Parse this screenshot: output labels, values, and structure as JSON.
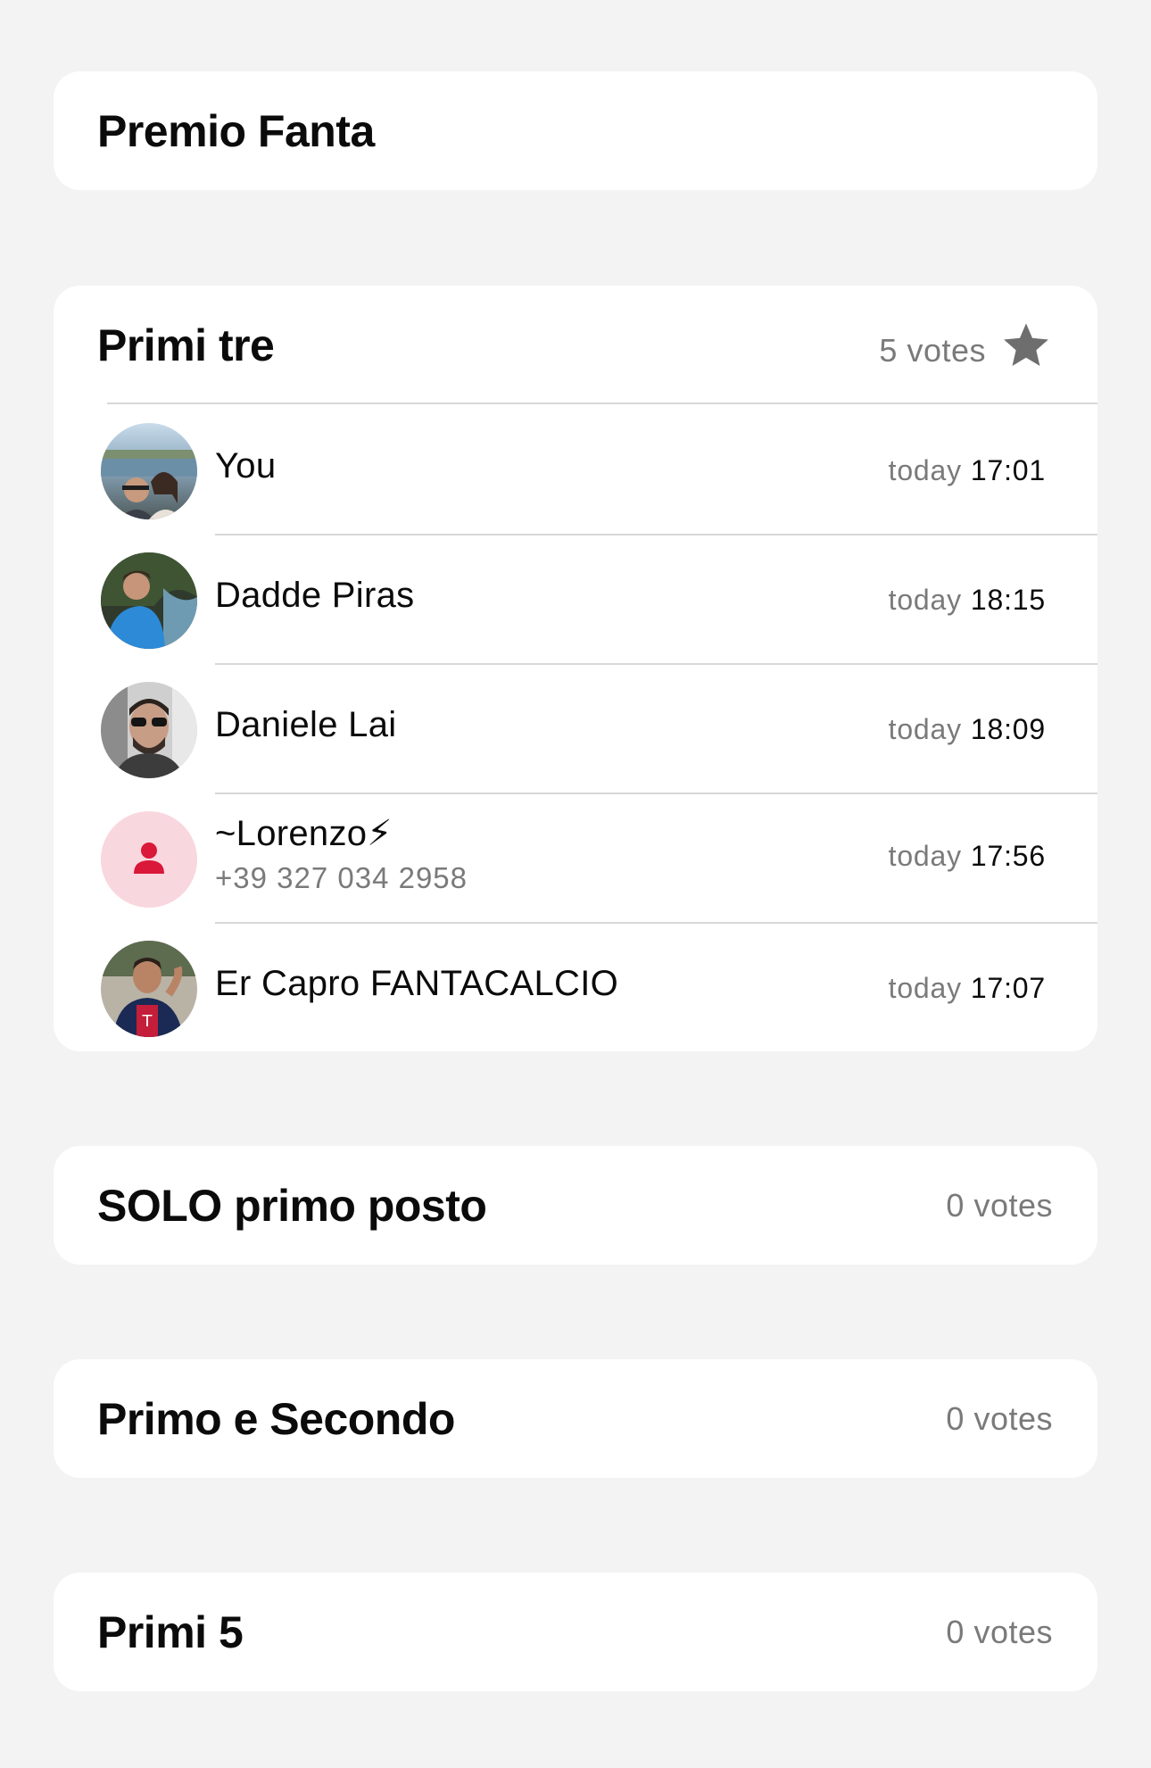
{
  "poll_title": "Premio Fanta",
  "options": [
    {
      "label": "Primi tre",
      "votes_text": "5 votes",
      "starred": true,
      "voters": [
        {
          "name": "You",
          "sub": "",
          "day": "today",
          "time": "17:01",
          "avatar": "photo-couple-avatar"
        },
        {
          "name": "Dadde Piras",
          "sub": "",
          "day": "today",
          "time": "18:15",
          "avatar": "photo-avatar"
        },
        {
          "name": "Daniele Lai",
          "sub": "",
          "day": "today",
          "time": "18:09",
          "avatar": "photo-avatar"
        },
        {
          "name": "~Lorenzo⚡",
          "sub": "+39 327 034 2958",
          "day": "today",
          "time": "17:56",
          "avatar": "person-placeholder-icon"
        },
        {
          "name": "Er Capro FANTACALCIO",
          "sub": "",
          "day": "today",
          "time": "17:07",
          "avatar": "photo-avatar"
        }
      ]
    },
    {
      "label": "SOLO primo posto",
      "votes_text": "0 votes"
    },
    {
      "label": "Primo e Secondo",
      "votes_text": "0 votes"
    },
    {
      "label": "Primi 5",
      "votes_text": "0 votes"
    }
  ],
  "colors": {
    "background": "#f3f3f3",
    "card": "#ffffff",
    "placeholder_avatar_bg": "#f9d7de",
    "placeholder_avatar_fg": "#d9183a",
    "lightning": "#f5c242"
  }
}
